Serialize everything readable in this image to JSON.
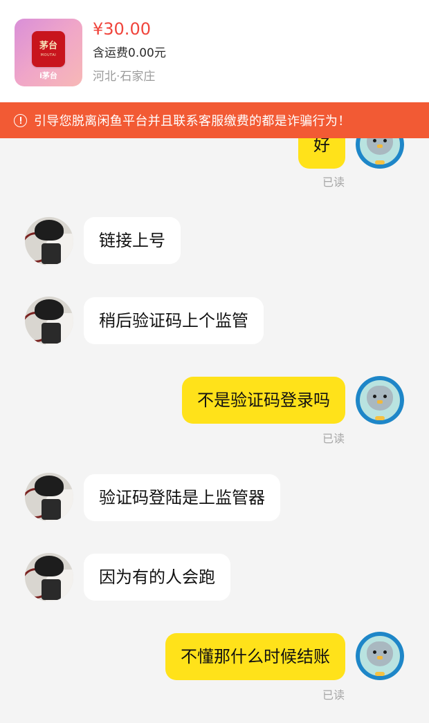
{
  "product": {
    "thumb_text": "茅台",
    "thumb_sub": "MOUTAI",
    "thumb_caption": "i茅台",
    "price": "¥30.00",
    "shipping": "含运费0.00元",
    "location": "河北·石家庄"
  },
  "warning": {
    "icon": "alert-circle-icon",
    "text": "引导您脱离闲鱼平台并且联系客服缴费的都是诈骗行为！"
  },
  "messages": [
    {
      "from": "me",
      "text": "好",
      "read": "已读"
    },
    {
      "from": "other",
      "text": "链接上号"
    },
    {
      "from": "other",
      "text": "稍后验证码上个监管"
    },
    {
      "from": "me",
      "text": "不是验证码登录吗",
      "read": "已读"
    },
    {
      "from": "other",
      "text": "验证码登陆是上监管器"
    },
    {
      "from": "other",
      "text": "因为有的人会跑"
    },
    {
      "from": "me",
      "text": "不懂那什么时候结账",
      "read": "已读"
    }
  ],
  "colors": {
    "price": "#f0453c",
    "warning_bg": "#f25a34",
    "outgoing_bubble": "#ffe21a",
    "incoming_bubble": "#ffffff",
    "background": "#f4f4f4"
  }
}
